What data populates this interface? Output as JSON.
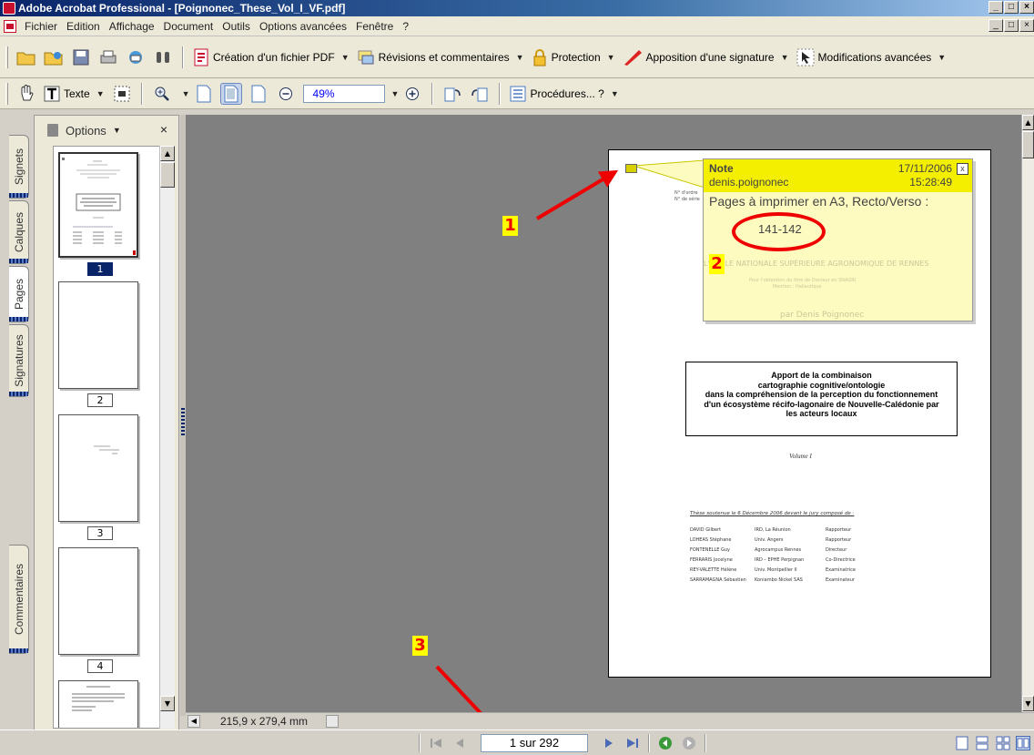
{
  "window": {
    "title": "Adobe Acrobat Professional - [Poignonec_These_Vol_I_VF.pdf]",
    "buttons": [
      "_",
      "×"
    ]
  },
  "menubar": {
    "items": [
      "Fichier",
      "Edition",
      "Affichage",
      "Document",
      "Outils",
      "Options avancées",
      "Fenêtre",
      "?"
    ]
  },
  "toolbar1": {
    "create_pdf": "Création d'un fichier PDF",
    "review": "Révisions et commentaires",
    "protection": "Protection",
    "signature": "Apposition d'une signature",
    "advanced": "Modifications avancées"
  },
  "toolbar2": {
    "text_tool": "Texte",
    "zoom_value": "49%",
    "procedures": "Procédures... ?"
  },
  "nav_tabs": [
    "Signets",
    "Calques",
    "Pages",
    "Signatures",
    "Commentaires"
  ],
  "panel": {
    "options_label": "Options",
    "close": "×",
    "page_numbers": [
      "1",
      "2",
      "3",
      "4"
    ]
  },
  "document": {
    "page_size": "215,9 x 279,4 mm",
    "header_lines": [
      "N° d'ordre",
      "N° de série"
    ],
    "school": "L'ÉCOLE NATIONALE SUPÉRIEURE AGRONOMIQUE DE RENNES",
    "degree": "Pour l'obtention du titre de Docteur en SNAGRI",
    "specialty": "Mention : Halieutique",
    "author_line": "par Denis Poignonec",
    "title_lines": [
      "Apport de la combinaison",
      "cartographie cognitive/ontologie",
      "dans la compréhension de la perception du fonctionnement",
      "d'un écosystème récifo-lagonaire de Nouvelle-Calédonie par",
      "les acteurs locaux"
    ],
    "volume": "Volume I",
    "jury_heading": "Thèse soutenue le 6 Décembre 2006 devant le jury composé de :",
    "jury": [
      [
        "DAVID Gilbert",
        "IRD, La Réunion",
        "Rapporteur"
      ],
      [
        "LOHEAS Stéphane",
        "Univ. Angers",
        "Rapporteur"
      ],
      [
        "FONTENELLE Guy",
        "Agrocampus Rennes",
        "Directeur"
      ],
      [
        "FERRARIS Jocelyne",
        "IRD – EPHE Perpignan",
        "Co-Directrice"
      ],
      [
        "REY-VALETTE Hélène",
        "Univ. Montpellier II",
        "Examinatrice"
      ],
      [
        "SARRAMAGNA Sébastien",
        "Koniambo Nickel SAS",
        "Examinateur"
      ]
    ]
  },
  "note": {
    "title": "Note",
    "author": "denis.poignonec",
    "date": "17/11/2006",
    "time": "15:28:49",
    "close": "x",
    "line1": "Pages à imprimer en A3, Recto/Verso :",
    "line2": "141-142"
  },
  "callouts": [
    "1",
    "2",
    "3"
  ],
  "statusbar": {
    "page_indicator": "1 sur 292"
  },
  "colors": {
    "note_header": "#f4ef00",
    "note_body": "#fdfbbf",
    "annotation_red": "#ee0000",
    "badge_yellow": "#ffff00"
  }
}
